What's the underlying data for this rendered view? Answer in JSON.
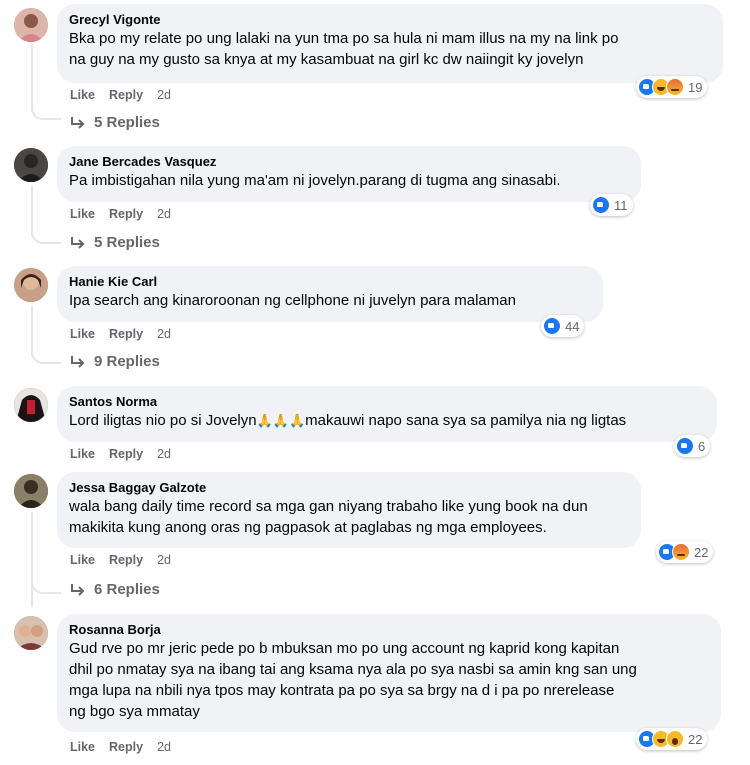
{
  "actions": {
    "like": "Like",
    "reply": "Reply"
  },
  "comments": [
    {
      "author": "Grecyl Vigonte",
      "lines": [
        "Bka po my relate po ung lalaki na yun tma po sa hula ni mam illus na my na link po",
        "na guy na my gusto sa knya at my kasambuat na girl kc dw naiingit ky jovelyn"
      ],
      "time": "2d",
      "reactions": [
        "like",
        "haha",
        "angry"
      ],
      "reaction_count": "19",
      "replies": "5 Replies",
      "avatar_color": "#c98f85"
    },
    {
      "author": "Jane Bercades Vasquez",
      "lines": [
        "Pa imbistigahan nila yung ma'am ni jovelyn.parang di tugma ang sinasabi."
      ],
      "time": "2d",
      "reactions": [
        "like"
      ],
      "reaction_count": "11",
      "replies": "5 Replies",
      "avatar_color": "#3d3a38"
    },
    {
      "author": "Hanie Kie Carl",
      "lines": [
        "Ipa search ang kinaroroonan ng cellphone ni juvelyn para malaman"
      ],
      "time": "2d",
      "reactions": [
        "like"
      ],
      "reaction_count": "44",
      "replies": "9 Replies",
      "avatar_color": "#b07a5a"
    },
    {
      "author": "Santos Norma",
      "lines_prefix": "Lord iligtas nio po si Jovelyn",
      "emoji": "🙏🙏🙏",
      "lines_suffix": "makauwi napo sana sya sa pamilya nia ng ligtas",
      "time": "2d",
      "reactions": [
        "like"
      ],
      "reaction_count": "6",
      "avatar_color": "#7a1f24"
    },
    {
      "author": "Jessa Baggay Galzote",
      "lines": [
        "wala bang daily time record sa mga gan niyang trabaho like yung book na dun",
        "makikita kung anong oras ng pagpasok at paglabas ng mga employees."
      ],
      "time": "2d",
      "reactions": [
        "like",
        "angry"
      ],
      "reaction_count": "22",
      "replies": "6 Replies",
      "avatar_color": "#5a4a3a"
    },
    {
      "author": "Rosanna Borja",
      "lines": [
        "Gud rve po mr jeric pede po b mbuksan mo po ung account ng kaprid kong kapitan",
        "dhil po nmatay sya na ibang tai ang ksama nya ala po sya nasbi sa amin kng san ung",
        "mga lupa na nbili nya tpos may kontrata pa po sya sa brgy na d i pa po nrerelease",
        "ng bgo sya mmatay"
      ],
      "time": "2d",
      "reactions": [
        "like",
        "haha",
        "wow"
      ],
      "reaction_count": "22",
      "avatar_color": "#a06048"
    }
  ]
}
